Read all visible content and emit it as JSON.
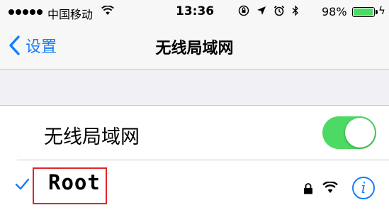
{
  "status_bar": {
    "carrier": "中国移动",
    "time": "13:36",
    "battery_percent": "98%",
    "battery_level": 0.98,
    "icons": [
      "signal-dots-icon",
      "wifi-icon",
      "rotation-lock-icon",
      "location-arrow-icon",
      "alarm-icon",
      "bluetooth-icon",
      "battery-icon",
      "charging-bolt-icon"
    ]
  },
  "nav": {
    "back_label": "设置",
    "title": "无线局域网"
  },
  "wifi_toggle": {
    "label": "无线局域网",
    "on": true
  },
  "current_network": {
    "name": "Root",
    "selected": true,
    "info_label": "i"
  },
  "colors": {
    "accent": "#157efb",
    "toggle_on": "#4cd964",
    "highlight_box": "#e0252b"
  }
}
